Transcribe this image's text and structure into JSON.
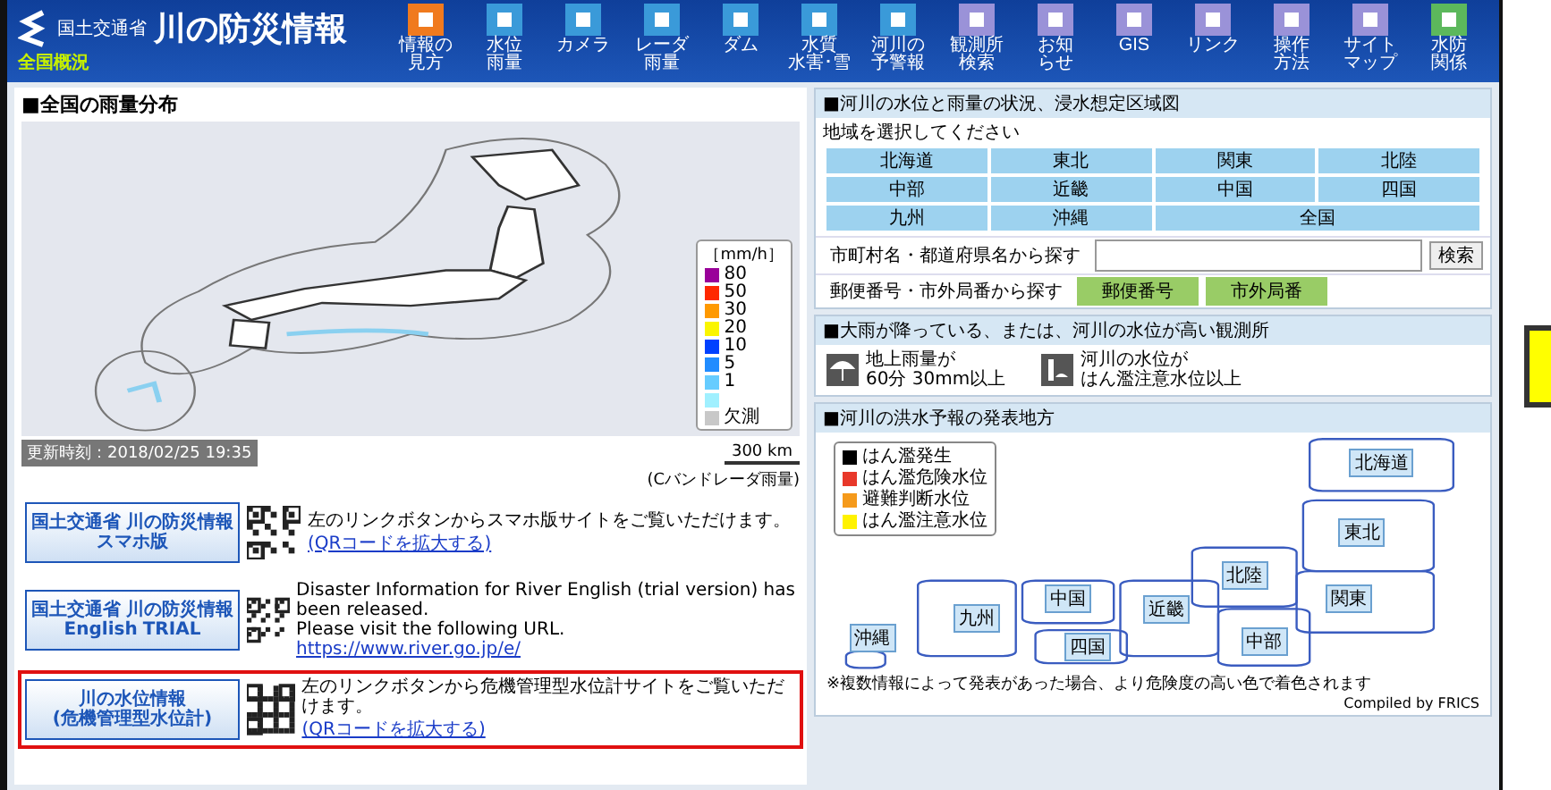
{
  "header": {
    "ministry": "国土交通省",
    "title": "川の防災情報",
    "subtitle": "全国概況",
    "menu": [
      {
        "label": [
          "情報の",
          "見方"
        ],
        "color": "#f07a1e"
      },
      {
        "label": [
          "水位",
          "雨量"
        ],
        "color": "#3a9ad9"
      },
      {
        "label": [
          "カメラ"
        ],
        "color": "#3a9ad9"
      },
      {
        "label": [
          "レーダ",
          "雨量"
        ],
        "color": "#3a9ad9"
      },
      {
        "label": [
          "ダム"
        ],
        "color": "#3a9ad9"
      },
      {
        "label": [
          "水質",
          "水害･雪"
        ],
        "color": "#3a9ad9"
      },
      {
        "label": [
          "河川の",
          "予警報"
        ],
        "color": "#3a9ad9"
      },
      {
        "label": [
          "観測所",
          "検索"
        ],
        "color": "#9a92d8"
      },
      {
        "label": [
          "お知",
          "らせ"
        ],
        "color": "#9a92d8"
      },
      {
        "label": [
          "GIS"
        ],
        "color": "#9a92d8"
      },
      {
        "label": [
          "リンク"
        ],
        "color": "#9a92d8"
      },
      {
        "label": [
          "操作",
          "方法"
        ],
        "color": "#9a92d8"
      },
      {
        "label": [
          "サイト",
          "マップ"
        ],
        "color": "#9a92d8"
      },
      {
        "label": [
          "水防",
          "関係"
        ],
        "color": "#5cb85c"
      }
    ]
  },
  "rain_map": {
    "title": "■全国の雨量分布",
    "unit": "［mm/h］",
    "legend": [
      {
        "label": "80",
        "color": "#990099"
      },
      {
        "label": "50",
        "color": "#ff2800"
      },
      {
        "label": "30",
        "color": "#ff9900"
      },
      {
        "label": "20",
        "color": "#faf500"
      },
      {
        "label": "10",
        "color": "#0041ff"
      },
      {
        "label": "5",
        "color": "#218cff"
      },
      {
        "label": "1",
        "color": "#66ccff"
      },
      {
        "color": "#a0f0ff"
      },
      {
        "label": "欠測",
        "color": "#c8c8c8"
      }
    ],
    "updated": "更新時刻：2018/02/25 19:35",
    "scale": "300 km",
    "caption": "(Cバンドレーダ雨量)"
  },
  "banners": [
    {
      "logo": [
        "国土交通省",
        "川の防災情報",
        "スマホ版"
      ],
      "text": "左のリンクボタンからスマホ版サイトをご覧いただけます。",
      "link": "(QRコードを拡大する)",
      "highlighted": false
    },
    {
      "logo": [
        "国土交通省",
        "川の防災情報",
        "English",
        "TRIAL"
      ],
      "text": "Disaster Information for River English (trial version) has been released.\nPlease visit the following URL.",
      "link": "https://www.river.go.jp/e/",
      "highlighted": false
    },
    {
      "logo": [
        "川の水位情報",
        "(危機管理型水位計)"
      ],
      "text": "左のリンクボタンから危機管理型水位計サイトをご覧いただけます。",
      "link": "(QRコードを拡大する)",
      "highlighted": true
    }
  ],
  "river_status": {
    "title": "■河川の水位と雨量の状況、浸水想定区域図",
    "prompt": "地域を選択してください",
    "regions": [
      "北海道",
      "東北",
      "関東",
      "北陸",
      "中部",
      "近畿",
      "中国",
      "四国",
      "九州",
      "沖縄",
      "全国"
    ],
    "search_label": "市町村名・都道府県名から探す",
    "search_button": "検索",
    "postal_label": "郵便番号・市外局番から探す",
    "postal_buttons": [
      "郵便番号",
      "市外局番"
    ]
  },
  "alerts": {
    "title": "■大雨が降っている、または、河川の水位が高い観測所",
    "items": [
      {
        "kind": "rain",
        "text": [
          "地上雨量が",
          "60分 30mm以上"
        ]
      },
      {
        "kind": "water",
        "text": [
          "河川の水位が",
          "はん濫注意水位以上"
        ]
      }
    ]
  },
  "flood": {
    "title": "■河川の洪水予報の発表地方",
    "legend": [
      {
        "label": "はん濫発生",
        "color": "#000000"
      },
      {
        "label": "はん濫危険水位",
        "color": "#e8382a"
      },
      {
        "label": "避難判断水位",
        "color": "#f59a1b"
      },
      {
        "label": "はん濫注意水位",
        "color": "#fff200"
      }
    ],
    "regions": [
      "北海道",
      "東北",
      "北陸",
      "関東",
      "中部",
      "近畿",
      "中国",
      "四国",
      "九州",
      "沖縄"
    ],
    "note": "※複数情報によって発表があった場合、より危険度の高い色で着色されます",
    "credit": "Compiled by FRICS"
  }
}
